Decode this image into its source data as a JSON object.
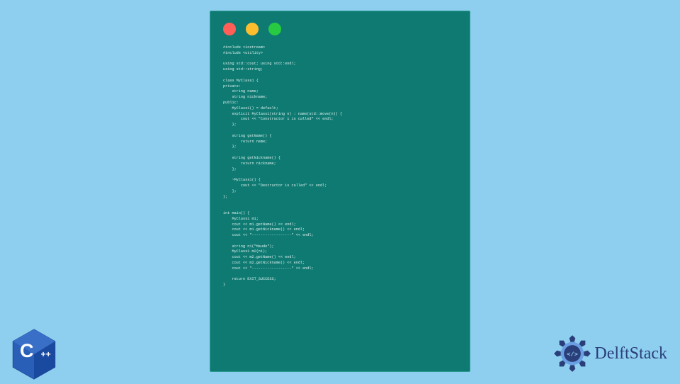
{
  "window": {
    "lights": [
      "red",
      "yellow",
      "green"
    ]
  },
  "code": {
    "lines": [
      "#include <iostream>",
      "#include <utility>",
      "",
      "using std::cout; using std::endl;",
      "using std::string;",
      "",
      "class MyClass1 {",
      "private:",
      "    string name;",
      "    string nickname;",
      "public:",
      "    MyClass1() = default;",
      "    explicit MyClass1(string n) : name(std::move(n)) {",
      "        cout << \"Constructor 1 is called\" << endl;",
      "    };",
      "",
      "    string getName() {",
      "        return name;",
      "    };",
      "",
      "    string getNickname() {",
      "        return nickname;",
      "    };",
      "",
      "    ~MyClass1() {",
      "        cout << \"Destructor is called\" << endl;",
      "    };",
      "};",
      "",
      "",
      "int main() {",
      "    MyClass1 m1;",
      "    cout << m1.getName() << endl;",
      "    cout << m1.getNickname() << endl;",
      "    cout << \"------------------\" << endl;",
      "",
      "    string n1(\"Maude\");",
      "    MyClass1 m2(n1);",
      "    cout << m2.getName() << endl;",
      "    cout << m2.getNickname() << endl;",
      "    cout << \"------------------\" << endl;",
      "",
      "    return EXIT_SUCCESS;",
      "}"
    ]
  },
  "badges": {
    "cpp_label": "C++",
    "delft_label": "DelftStack"
  },
  "colors": {
    "bg": "#8ecff0",
    "window": "#0f7a72",
    "code_text": "#d9f0ee",
    "cpp_blue": "#2a5fb8",
    "delft_blue": "#2a3f7a",
    "delft_accent": "#4a7fd4"
  }
}
